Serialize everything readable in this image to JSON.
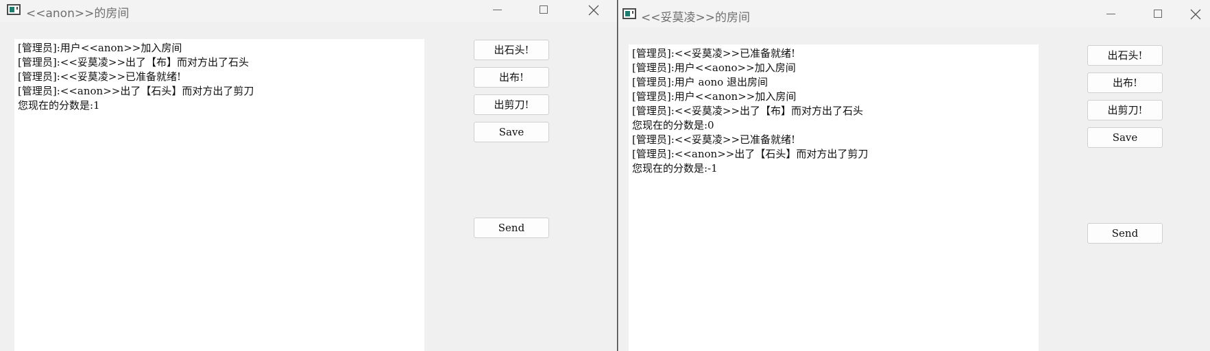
{
  "left_window": {
    "title": "<<anon>>的房间",
    "log_lines": [
      "[管理员]:用户<<anon>>加入房间",
      "[管理员]:<<妥莫凌>>出了【布】而对方出了石头",
      "[管理员]:<<妥莫凌>>已准备就绪!",
      "[管理员]:<<anon>>出了【石头】而对方出了剪刀",
      "您现在的分数是:1"
    ],
    "buttons": {
      "rock": "出石头!",
      "paper": "出布!",
      "scissors": "出剪刀!",
      "save": "Save",
      "send": "Send"
    }
  },
  "right_window": {
    "title": "<<妥莫凌>>的房间",
    "log_lines": [
      "[管理员]:<<妥莫凌>>已准备就绪!",
      "[管理员]:用户<<aono>>加入房间",
      "[管理员]:用户 aono 退出房间",
      "[管理员]:用户<<anon>>加入房间",
      "[管理员]:<<妥莫凌>>出了【布】而对方出了石头",
      "您现在的分数是:0",
      "[管理员]:<<妥莫凌>>已准备就绪!",
      "[管理员]:<<anon>>出了【石头】而对方出了剪刀",
      "您现在的分数是:-1"
    ],
    "buttons": {
      "rock": "出石头!",
      "paper": "出布!",
      "scissors": "出剪刀!",
      "save": "Save",
      "send": "Send"
    }
  },
  "icons": {
    "app": "window-app-icon",
    "minimize": "minimize-icon",
    "maximize": "maximize-icon",
    "close": "close-icon"
  }
}
